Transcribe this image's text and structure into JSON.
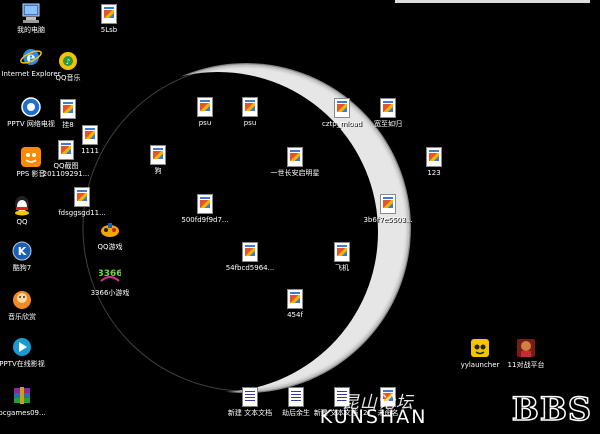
{
  "desktop": {
    "icons": [
      {
        "id": "my-computer",
        "label": "我的电脑",
        "icon": "computer-icon"
      },
      {
        "id": "5lsb",
        "label": "5Lsb",
        "icon": "document-icon"
      },
      {
        "id": "ie",
        "label": "Internet Explorer",
        "icon": "internet-explorer-icon"
      },
      {
        "id": "qq-music",
        "label": "QQ音乐",
        "icon": "qq-music-icon"
      },
      {
        "id": "pptv",
        "label": "PPTV 网络电视",
        "icon": "pptv-icon"
      },
      {
        "id": "gua8",
        "label": "挂8",
        "icon": "image-file-icon"
      },
      {
        "id": "1111",
        "label": "1111",
        "icon": "image-file-icon"
      },
      {
        "id": "pps",
        "label": "PPS 影音",
        "icon": "pps-icon"
      },
      {
        "id": "qq-screenshot",
        "label": "QQ截图 201109291...",
        "icon": "image-file-icon"
      },
      {
        "id": "fdsggsgd",
        "label": "fdsggsgd11...",
        "icon": "image-file-icon"
      },
      {
        "id": "qq",
        "label": "QQ",
        "icon": "qq-penguin-icon"
      },
      {
        "id": "qq-games",
        "label": "QQ游戏",
        "icon": "qq-games-icon"
      },
      {
        "id": "kugou",
        "label": "酷狗7",
        "icon": "kugou-icon"
      },
      {
        "id": "3366",
        "label": "3366小游戏",
        "icon": "3366-games-icon"
      },
      {
        "id": "music-box",
        "label": "音乐欣赏",
        "icon": "music-box-icon"
      },
      {
        "id": "pptv-movie",
        "label": "PPTV在线影视",
        "icon": "pptv-online-icon"
      },
      {
        "id": "pcgames",
        "label": "pcgames09...",
        "icon": "winrar-archive-icon"
      },
      {
        "id": "psu1",
        "label": "psu",
        "icon": "image-file-icon"
      },
      {
        "id": "psu2",
        "label": "psu",
        "icon": "image-file-icon"
      },
      {
        "id": "gou",
        "label": "狗",
        "icon": "image-file-icon"
      },
      {
        "id": "500fd",
        "label": "500fd9f9d7...",
        "icon": "image-file-icon"
      },
      {
        "id": "54fbcd",
        "label": "54fbcd5964...",
        "icon": "image-file-icon"
      },
      {
        "id": "feiji",
        "label": "飞机",
        "icon": "image-file-icon"
      },
      {
        "id": "454f",
        "label": "454f",
        "icon": "image-file-icon"
      },
      {
        "id": "yishi",
        "label": "一世长安启明星",
        "icon": "image-file-icon"
      },
      {
        "id": "download",
        "label": "cztp_mload",
        "icon": "image-file-icon"
      },
      {
        "id": "kuanzhi",
        "label": "宽至如归",
        "icon": "image-file-icon"
      },
      {
        "id": "3b6",
        "label": "3b6f7e5503...",
        "icon": "image-file-icon"
      },
      {
        "id": "123",
        "label": "123",
        "icon": "image-file-icon"
      },
      {
        "id": "new-txt-1",
        "label": "新建 文本文档",
        "icon": "text-file-icon"
      },
      {
        "id": "jiehou",
        "label": "劫后余生",
        "icon": "text-file-icon"
      },
      {
        "id": "new-txt-2",
        "label": "新建 文本文档 (2)",
        "icon": "text-file-icon"
      },
      {
        "id": "weiming",
        "label": "未命名",
        "icon": "image-file-icon"
      },
      {
        "id": "yylauncher",
        "label": "yylauncher",
        "icon": "yy-launcher-icon"
      },
      {
        "id": "11platform",
        "label": "11对战平台",
        "icon": "11-platform-icon"
      }
    ]
  },
  "watermark": {
    "cn": "昆山论坛",
    "en": "KUNSHAN",
    "bbs": "BBS"
  },
  "colors": {
    "background": "#000000",
    "arc": "#ffffff"
  }
}
